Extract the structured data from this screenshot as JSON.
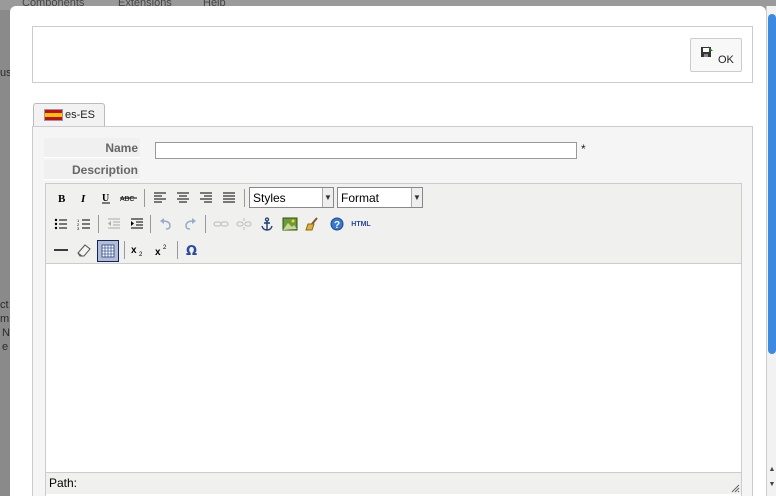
{
  "background": {
    "menu_items": [
      "Components",
      "Extensions",
      "Help"
    ],
    "fragments": [
      "us",
      "ct",
      "m",
      "N",
      "e"
    ]
  },
  "toolbar_panel": {
    "ok_label": "OK"
  },
  "language_tab": {
    "label": "es-ES"
  },
  "form": {
    "name_label": "Name",
    "name_value": "",
    "required_mark": "*",
    "description_label": "Description"
  },
  "editor": {
    "styles_select": "Styles",
    "format_select": "Format",
    "html_button": "HTML",
    "path_label": "Path:"
  },
  "colors": {
    "modal_bg": "#ffffff",
    "overlay": "#8a8a8a",
    "scroll_thumb": "#3b8ae0"
  }
}
